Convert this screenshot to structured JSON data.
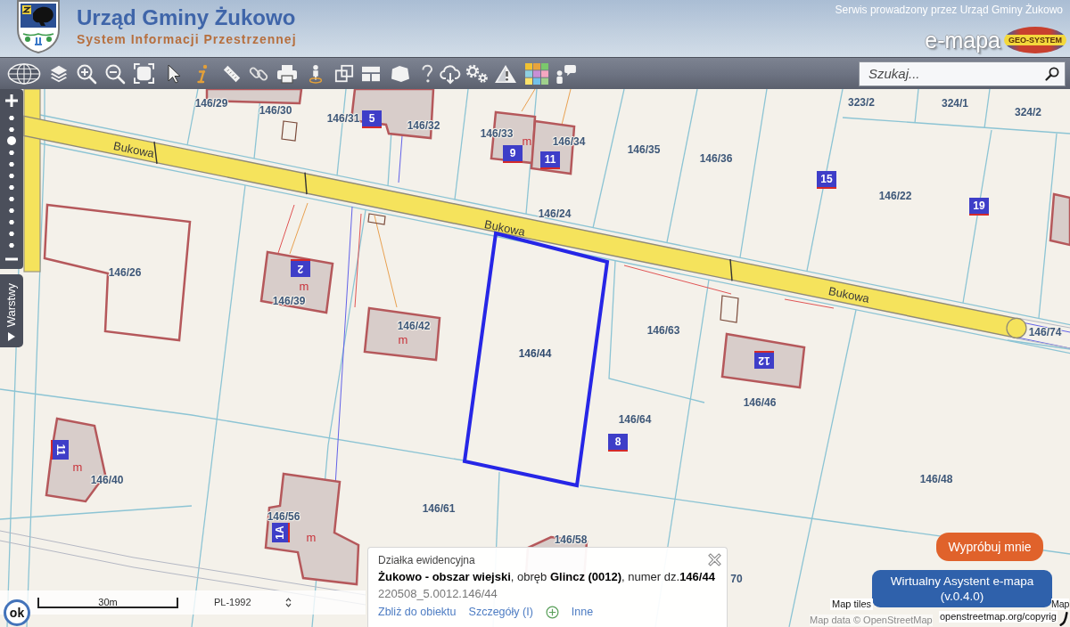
{
  "header": {
    "title": "Urząd Gminy Żukowo",
    "subtitle": "System Informacji Przestrzennej",
    "operator_note": "Serwis prowadzony przez Urząd Gminy Żukowo",
    "brand": "e-mapa",
    "brand_logo_text": "GEO-SYSTEM"
  },
  "toolbar": {
    "search": {
      "placeholder": "Szukaj..."
    }
  },
  "zoom": {
    "level": 0.82
  },
  "layers_tab": {
    "label": "Warstwy",
    "expanded": false
  },
  "map": {
    "street_labels": [
      "Bukowa",
      "Bukowa",
      "Bukowa"
    ],
    "parcels": [
      {
        "label": "146/29",
        "selected": false
      },
      {
        "label": "146/30",
        "selected": false
      },
      {
        "label": "146/31",
        "selected": false
      },
      {
        "label": "146/32",
        "selected": false
      },
      {
        "label": "146/33",
        "selected": false
      },
      {
        "label": "146/34",
        "selected": false
      },
      {
        "label": "146/35",
        "selected": false
      },
      {
        "label": "146/36",
        "selected": false
      },
      {
        "label": "323/2",
        "selected": false
      },
      {
        "label": "324/1",
        "selected": false
      },
      {
        "label": "324/2",
        "selected": false
      },
      {
        "label": "146/22",
        "selected": false
      },
      {
        "label": "146/24",
        "selected": false
      },
      {
        "label": "146/26",
        "selected": false
      },
      {
        "label": "146/39",
        "selected": false
      },
      {
        "label": "146/42",
        "selected": false
      },
      {
        "label": "146/44",
        "selected": true
      },
      {
        "label": "146/63",
        "selected": false
      },
      {
        "label": "146/74",
        "selected": false
      },
      {
        "label": "146/46",
        "selected": false
      },
      {
        "label": "146/64",
        "selected": false
      },
      {
        "label": "146/48",
        "selected": false
      },
      {
        "label": "146/40",
        "selected": false
      },
      {
        "label": "146/56",
        "selected": false
      },
      {
        "label": "146/61",
        "selected": false
      },
      {
        "label": "146/58",
        "selected": false
      },
      {
        "label": "70",
        "selected": false
      }
    ],
    "house_numbers": [
      "5",
      "9",
      "11",
      "15",
      "19",
      "2",
      "12",
      "8",
      "11",
      "1A"
    ],
    "building_marks": [
      "m",
      "m",
      "m",
      "m",
      "m"
    ]
  },
  "scale_bar": {
    "label": "30m",
    "projection": "PL-1992"
  },
  "accessibility_button": "ok",
  "popup": {
    "heading": "Działka ewidencyjna",
    "description": "**Żukowo - obszar wiejski**, obręb **Glincz (0012)**, numer dz.**146/44**",
    "identifier": "220508_5.0012.146/44",
    "actions": [
      {
        "label": "Zbliż do obiektu",
        "kind": "link"
      },
      {
        "label": "Szczegóły (I)",
        "kind": "link"
      },
      {
        "label": "Inne",
        "kind": "more"
      }
    ]
  },
  "assistant": {
    "prompt": "Wypróbuj mnie",
    "button": "Wirtualny Asystent e-mapa (v.0.4.0)"
  },
  "attribution": {
    "tiles": "Map tiles",
    "tiles_end": "Map",
    "data": "Map data © OpenStreetMap",
    "link": "openstreetmap.org/copyrig"
  }
}
